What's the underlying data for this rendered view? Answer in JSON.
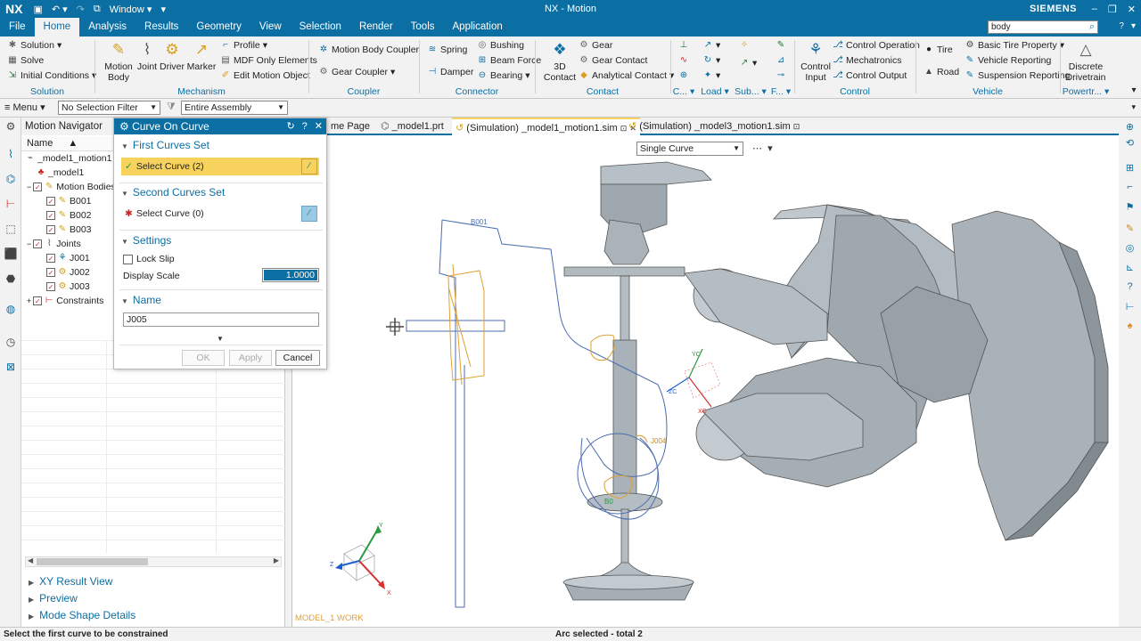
{
  "titlebar": {
    "app": "NX",
    "window_menu": "Window",
    "title": "NX - Motion",
    "brand": "SIEMENS"
  },
  "menubar": {
    "tabs": [
      "File",
      "Home",
      "Analysis",
      "Results",
      "Geometry",
      "View",
      "Selection",
      "Render",
      "Tools",
      "Application"
    ],
    "active": "Home",
    "search_value": "body"
  },
  "ribbon": {
    "solution": {
      "label": "Solution",
      "items": [
        "Solution",
        "Solve",
        "Initial Conditions"
      ]
    },
    "mechanism": {
      "label": "Mechanism",
      "big": [
        "Motion Body",
        "Joint",
        "Driver",
        "Marker"
      ],
      "small": [
        "Profile",
        "MDF Only Elements",
        "Edit Motion Object"
      ]
    },
    "coupler": {
      "label": "Coupler",
      "items": [
        "Motion Body Coupler",
        "Gear Coupler"
      ]
    },
    "connector": {
      "label": "Connector",
      "items": [
        "Spring",
        "Damper",
        "Bushing",
        "Beam Force",
        "Bearing"
      ]
    },
    "contact": {
      "label": "Contact",
      "big": "3D Contact",
      "items": [
        "Gear",
        "Gear Contact",
        "Analytical Contact"
      ]
    },
    "c_group": {
      "label": "C..."
    },
    "load": {
      "label": "Load"
    },
    "sub": {
      "label": "Sub..."
    },
    "f_group": {
      "label": "F..."
    },
    "control": {
      "label": "Control",
      "big": "Control Input",
      "items": [
        "Control Operation",
        "Mechatronics",
        "Control Output"
      ]
    },
    "vehicle": {
      "label": "Vehicle",
      "items": [
        "Tire",
        "Road",
        "Basic Tire Property",
        "Vehicle Reporting",
        "Suspension Reporting"
      ]
    },
    "powertrain": {
      "label": "Powertr...",
      "big": "Discrete Drivetrain"
    }
  },
  "selbar": {
    "menu": "Menu",
    "filter": "No Selection Filter",
    "scope": "Entire Assembly"
  },
  "navigator": {
    "title": "Motion Navigator",
    "column": "Name",
    "tree": [
      {
        "label": "_model1_motion1",
        "level": 0
      },
      {
        "label": "_model1",
        "level": 1
      },
      {
        "label": "Motion Bodies",
        "level": 1
      },
      {
        "label": "B001",
        "level": 2
      },
      {
        "label": "B002",
        "level": 2
      },
      {
        "label": "B003",
        "level": 2
      },
      {
        "label": "Joints",
        "level": 1
      },
      {
        "label": "J001",
        "level": 2
      },
      {
        "label": "J002",
        "level": 2
      },
      {
        "label": "J003",
        "level": 2
      },
      {
        "label": "Constraints",
        "level": 1
      }
    ],
    "bottom_panels": [
      "XY Result View",
      "Preview",
      "Mode Shape Details"
    ]
  },
  "dialog": {
    "title": "Curve On Curve",
    "first_set": {
      "header": "First Curves Set",
      "select": "Select Curve (2)"
    },
    "second_set": {
      "header": "Second Curves Set",
      "select": "Select Curve (0)"
    },
    "settings": {
      "header": "Settings",
      "lock_slip": "Lock Slip",
      "display_scale_label": "Display Scale",
      "display_scale_value": "1.0000"
    },
    "name": {
      "header": "Name",
      "value": "J005"
    },
    "buttons": {
      "ok": "OK",
      "apply": "Apply",
      "cancel": "Cancel"
    }
  },
  "tabs": [
    {
      "label": "me Page",
      "active": false
    },
    {
      "label": "_model1.prt",
      "active": false
    },
    {
      "label": "(Simulation) _model1_motion1.sim",
      "active": true
    },
    {
      "label": "(Simulation) _model3_motion1.sim",
      "active": false
    }
  ],
  "viewport": {
    "curve_rule": "Single Curve",
    "work_label": "MODEL_1 WORK",
    "labels": {
      "b001": "B001",
      "j004": "J004",
      "b0x": "B0",
      "xc": "XC",
      "yc": "YC",
      "zc": "ZC"
    },
    "triad": {
      "x": "X",
      "y": "Y",
      "z": "Z"
    }
  },
  "status": {
    "left": "Select the first curve to be constrained",
    "center": "Arc selected - total 2"
  },
  "colors": {
    "accent": "#0b6fa4",
    "highlight": "#f7d35d",
    "part_fill": "#a8b3b9",
    "curve": "#4b6db0",
    "joint": "#e0a030"
  }
}
